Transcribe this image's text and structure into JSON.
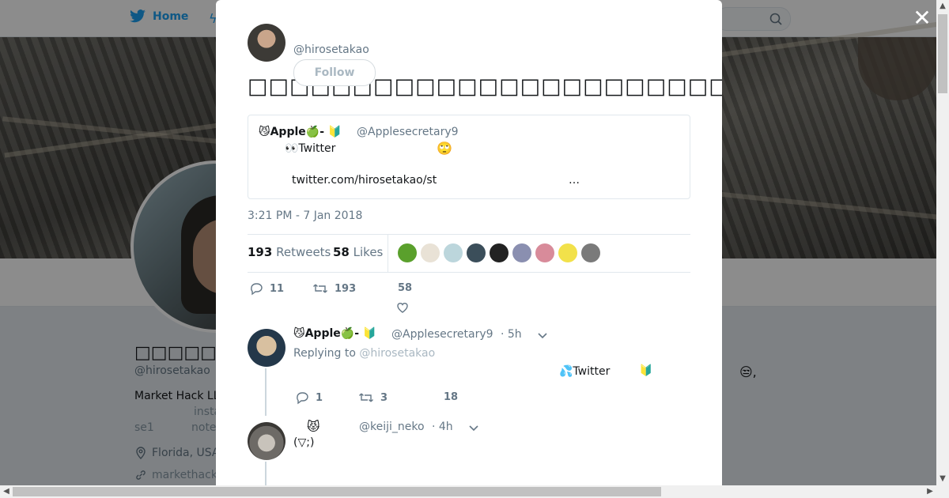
{
  "nav": {
    "home_label": "Home"
  },
  "profile": {
    "name": "□□□□□",
    "handle": "@hirosetakao",
    "bio": "Market Hack LL",
    "bio_sub_left": "se1",
    "bio_sub_mid": "insta",
    "bio_sub_mid2": "note",
    "location": "Florida, USA",
    "website": "markethack"
  },
  "tweet": {
    "handle": "@hirosetakao",
    "follow_label": "Follow",
    "text": "□□□□□□□□□□□□□□□□□□□□□□□□□□□w",
    "timestamp": "3:21 PM - 7 Jan 2018",
    "retweet_count": "193",
    "retweet_label": "Retweets",
    "like_count": "58",
    "like_label": "Likes",
    "actions": {
      "reply": "11",
      "retweet": "193",
      "like": "58"
    }
  },
  "quote": {
    "name": "😼Apple🍏-",
    "badge": "🔰",
    "handle": "@Applesecretary9",
    "line1": "👀Twitter",
    "line1_emoji": "🙄",
    "link": "twitter.com/hirosetakao/st",
    "ellipsis": "…"
  },
  "likers": [
    "#5aa02c",
    "#e9e2d6",
    "#bcd6dc",
    "#3b4e5a",
    "#222222",
    "#8a8fb0",
    "#d88b9a",
    "#f2e14a",
    "#7a7a7a"
  ],
  "replies": [
    {
      "name": "😼Apple🍏-",
      "badge": "🔰",
      "handle": "@Applesecretary9",
      "time": "· 5h",
      "replying_prefix": "Replying to",
      "replying_handle": "@hirosetakao",
      "text": "💦Twitter",
      "text_badge": "🔰",
      "actions": {
        "reply": "1",
        "retweet": "3",
        "like": "18"
      }
    },
    {
      "name": "😾",
      "handle": "@keiji_neko",
      "time": "· 4h",
      "text": "(▽;)"
    }
  ],
  "right_emoji": "😒,"
}
